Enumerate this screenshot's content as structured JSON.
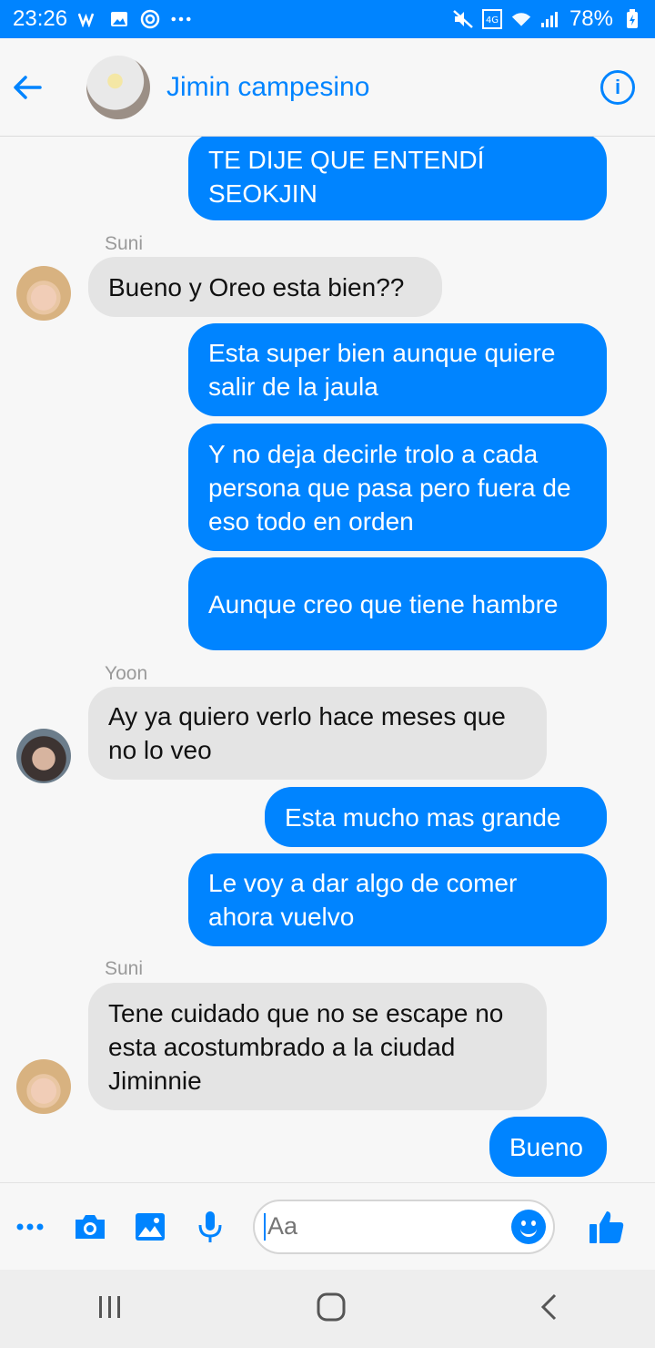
{
  "status": {
    "time": "23:26",
    "battery": "78%"
  },
  "header": {
    "contact_name": "Jimin campesino"
  },
  "messages": {
    "m1": "TE DIJE QUE ENTENDÍ SEOKJIN",
    "suni_label_1": "Suni",
    "m2": "Bueno y Oreo esta bien??",
    "m3": "Esta super bien aunque quiere salir de la jaula",
    "m4": "Y no deja decirle trolo a cada persona que pasa pero fuera de eso todo en orden",
    "m5": "Aunque creo que tiene hambre",
    "yoon_label": "Yoon",
    "m6": "Ay ya quiero verlo hace meses que no lo veo",
    "m7": "Esta mucho mas grande",
    "m8": "Le voy a dar algo de comer ahora vuelvo",
    "suni_label_2": "Suni",
    "m9": "Tene cuidado que no se escape no esta acostumbrado a la ciudad Jiminnie",
    "m10": "Bueno"
  },
  "composer": {
    "placeholder": "Aa"
  },
  "colors": {
    "accent": "#0084ff",
    "incoming": "#e4e4e4"
  },
  "icons": [
    "back-arrow-icon",
    "info-icon",
    "more-icon",
    "camera-icon",
    "image-icon",
    "microphone-icon",
    "emoji-icon",
    "like-icon",
    "recent-apps-icon",
    "home-icon",
    "back-nav-icon"
  ]
}
